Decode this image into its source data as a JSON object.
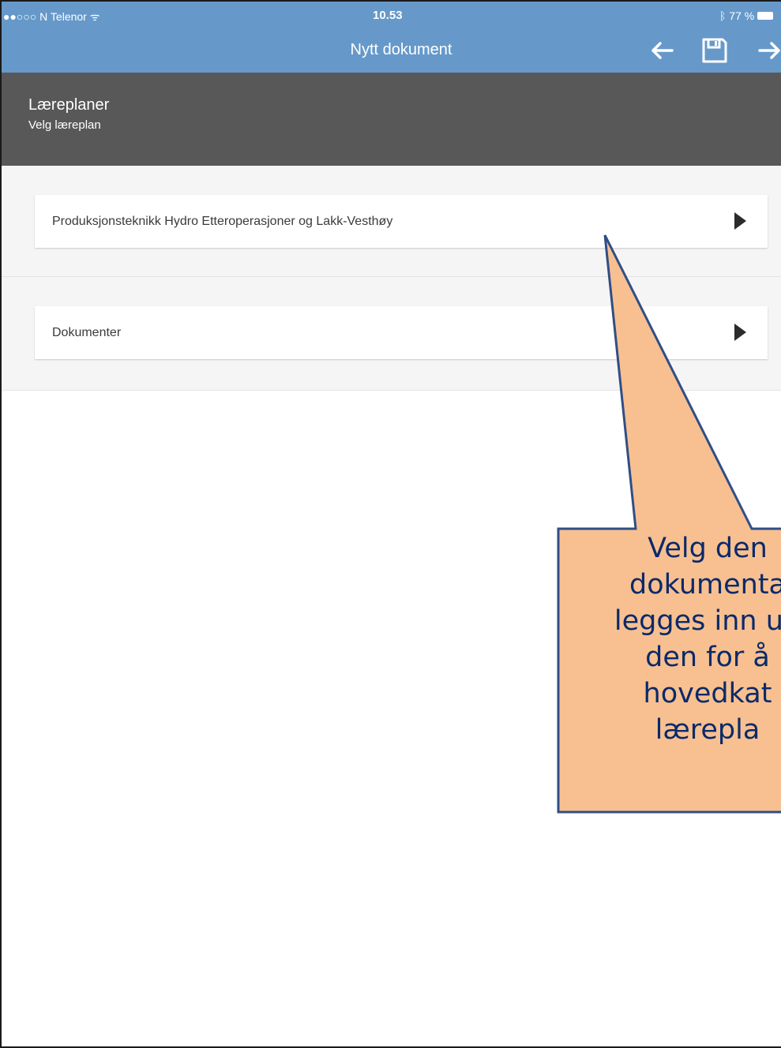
{
  "status_bar": {
    "carrier": "●●○○○ N Telenor ᯤ",
    "time": "10.53",
    "battery": "ᛒ 77 %"
  },
  "nav": {
    "title": "Nytt dokument",
    "back_icon": "arrow-left-icon",
    "save_icon": "floppy-disk-icon",
    "forward_icon": "arrow-right-icon"
  },
  "header": {
    "title": "Læreplaner",
    "subtitle": "Velg læreplan"
  },
  "list": {
    "items": [
      {
        "label": "Produksjonsteknikk Hydro Etteroperasjoner og Lakk-Vesthøy"
      },
      {
        "label": "Dokumenter"
      }
    ]
  },
  "callout": {
    "lines": [
      "Velg den",
      "dokumenta",
      "legges inn un",
      "den for å",
      "hovedkat",
      "lærepla"
    ],
    "fill": "#f8c090",
    "border": "#304e86"
  },
  "colors": {
    "accent": "#6699c9",
    "header_bg": "#585858"
  }
}
